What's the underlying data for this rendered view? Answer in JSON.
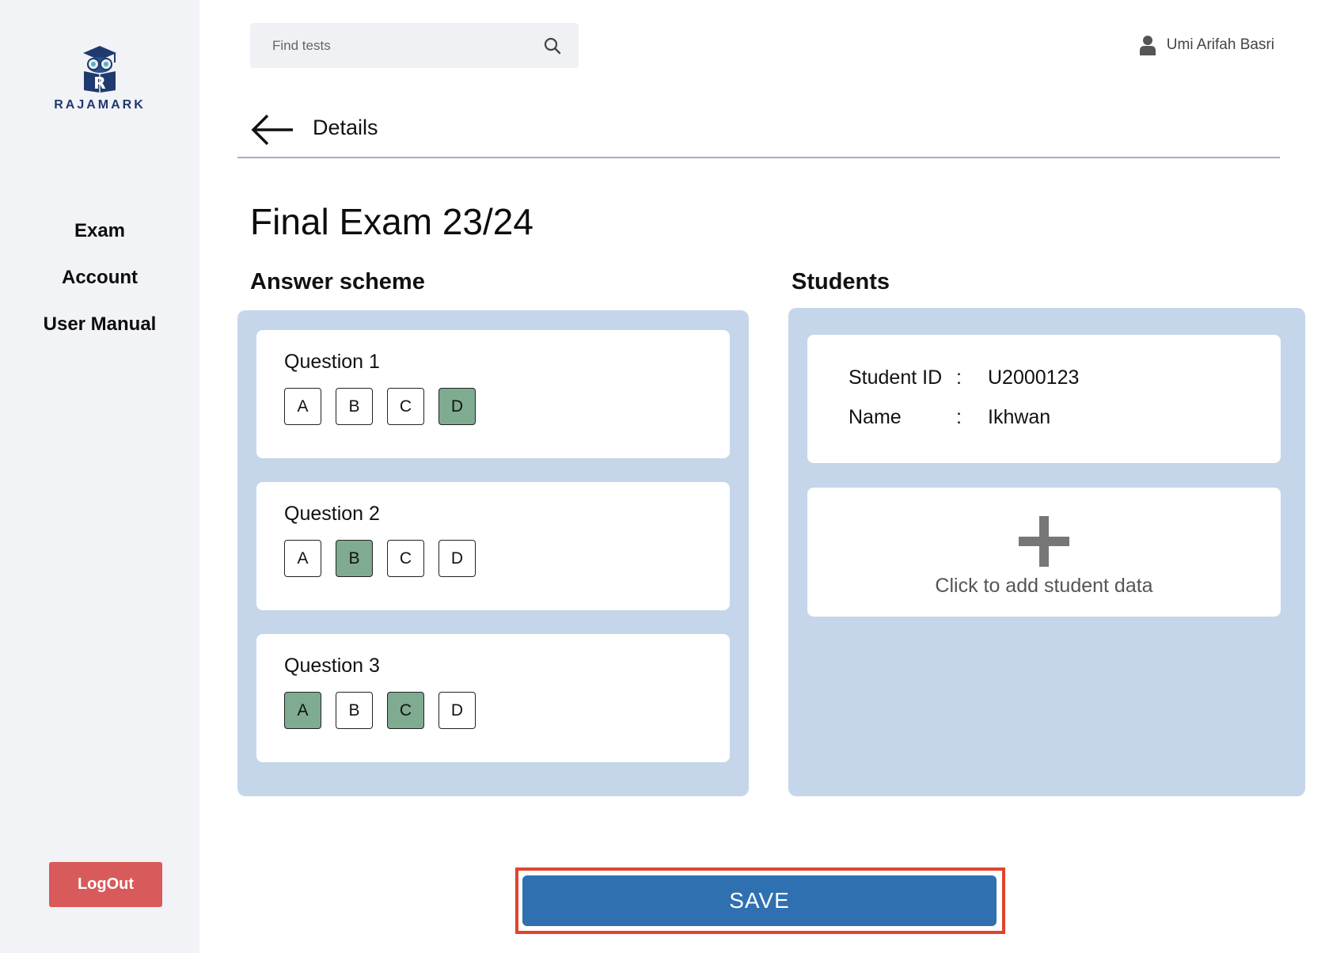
{
  "brand": {
    "name": "RAJAMARK",
    "colors": {
      "navy": "#1f3a6e",
      "accent": "#2f70b1",
      "selected": "#7fab90",
      "danger": "#d85a5a",
      "panel": "#c5d6eb"
    }
  },
  "sidebar": {
    "items": [
      {
        "label": "Exam"
      },
      {
        "label": "Account"
      },
      {
        "label": "User Manual"
      }
    ],
    "logout_label": "LogOut"
  },
  "search": {
    "placeholder": "Find tests",
    "icon": "search-icon"
  },
  "user": {
    "name": "Umi Arifah Basri",
    "icon": "user-icon"
  },
  "header": {
    "title": "Details",
    "back_icon": "arrow-left-icon"
  },
  "exam": {
    "title": "Final Exam 23/24"
  },
  "answer_scheme": {
    "title": "Answer scheme",
    "questions": [
      {
        "label": "Question 1",
        "options": [
          "A",
          "B",
          "C",
          "D"
        ],
        "selected": [
          "D"
        ]
      },
      {
        "label": "Question 2",
        "options": [
          "A",
          "B",
          "C",
          "D"
        ],
        "selected": [
          "B"
        ]
      },
      {
        "label": "Question 3",
        "options": [
          "A",
          "B",
          "C",
          "D"
        ],
        "selected": [
          "A",
          "C"
        ]
      }
    ]
  },
  "students": {
    "title": "Students",
    "student": {
      "id_label": "Student ID",
      "id_sep": ":",
      "id_value": "U2000123",
      "name_label": "Name",
      "name_sep": ":",
      "name_value": "Ikhwan"
    },
    "add_label": "Click to add student data",
    "add_icon": "plus-icon"
  },
  "save_label": "SAVE"
}
